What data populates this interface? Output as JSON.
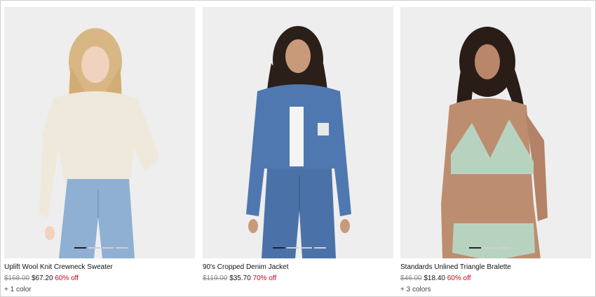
{
  "products": [
    {
      "name": "Uplift Wool Knit Crewneck Sweater",
      "original_price": "$168.00",
      "sale_price": "$67.20",
      "discount": "60% off",
      "colors": "+ 1 color",
      "image_icon": "product-photo-sweater",
      "carousel_dots": 4,
      "active_dot": 0
    },
    {
      "name": "90's Cropped Denim Jacket",
      "original_price": "$119.00",
      "sale_price": "$35.70",
      "discount": "70% off",
      "colors": "",
      "image_icon": "product-photo-denim-jacket",
      "carousel_dots": 4,
      "active_dot": 0
    },
    {
      "name": "Standards Unlined Triangle Bralette",
      "original_price": "$46.00",
      "sale_price": "$18.40",
      "discount": "60% off",
      "colors": "+ 3 colors",
      "image_icon": "product-photo-bralette",
      "carousel_dots": 3,
      "active_dot": 0
    }
  ],
  "theme": {
    "discount_color": "#d0021b",
    "strike_color": "#8a8a8a",
    "image_bg": "#eeeeee"
  }
}
